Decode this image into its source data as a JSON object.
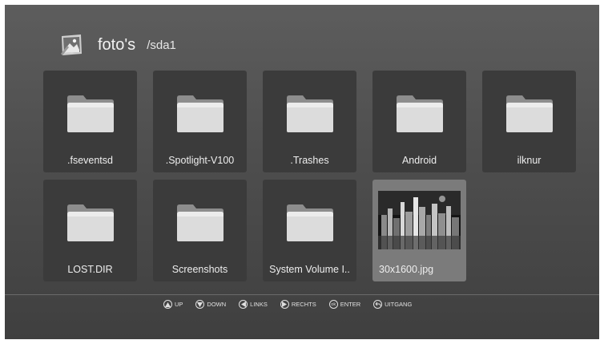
{
  "header": {
    "title": "foto's",
    "path": "/sda1"
  },
  "items": [
    {
      "label": ".fseventsd",
      "type": "folder"
    },
    {
      "label": ".Spotlight-V100",
      "type": "folder"
    },
    {
      "label": ".Trashes",
      "type": "folder"
    },
    {
      "label": "Android",
      "type": "folder"
    },
    {
      "label": "ilknur",
      "type": "folder"
    },
    {
      "label": "LOST.DIR",
      "type": "folder"
    },
    {
      "label": "Screenshots",
      "type": "folder"
    },
    {
      "label": "System Volume I..",
      "type": "folder"
    },
    {
      "label": "30x1600.jpg",
      "type": "image",
      "selected": true
    }
  ],
  "footer": {
    "up": "UP",
    "down": "DOWN",
    "left": "LINKS",
    "right": "RECHTS",
    "ok_icon": "ok",
    "enter": "ENTER",
    "exit": "UITGANG"
  },
  "colors": {
    "selected_tile": "#7b7b7b",
    "tile": "#3b3b3b",
    "background": "#4e4e4e"
  }
}
